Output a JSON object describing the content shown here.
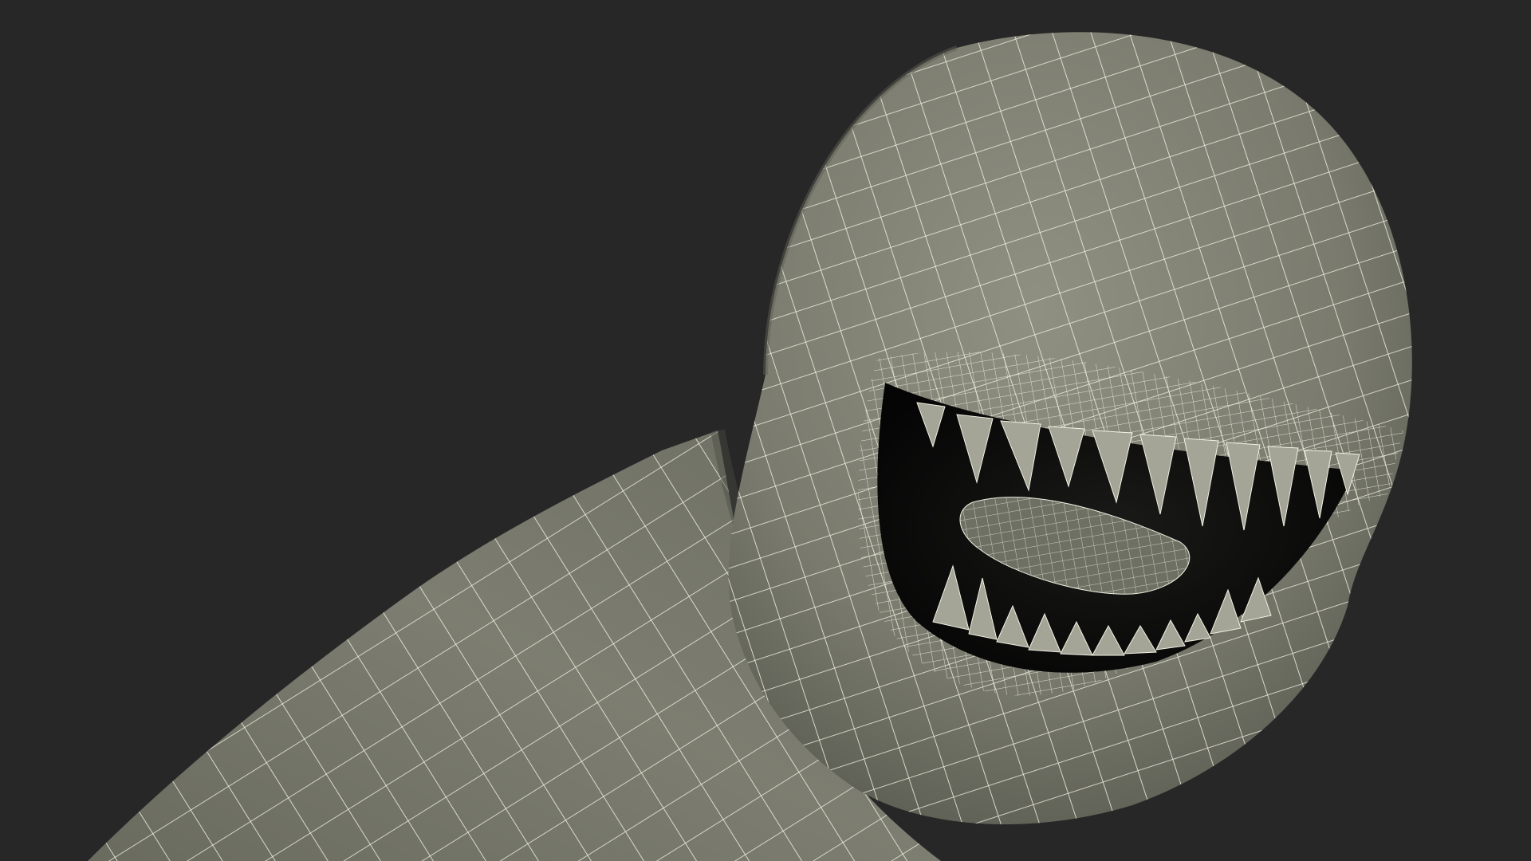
{
  "scene": {
    "subject": "wireframe-creature-head",
    "colors": {
      "background": "#272727",
      "surface": "#7c7d70",
      "surface_light": "#9a9b8c",
      "surface_dark": "#4d4e45",
      "wire": "#f2f1e4",
      "mouth_interior": "#0c0c0b"
    }
  }
}
